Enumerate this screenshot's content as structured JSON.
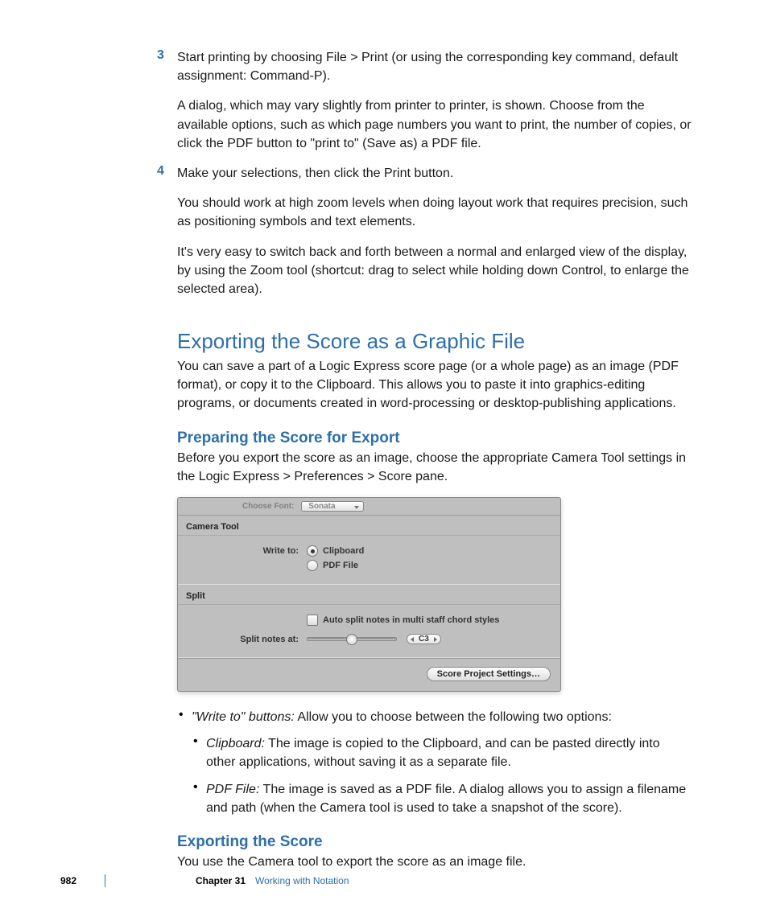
{
  "steps": {
    "s3": {
      "num": "3",
      "main": "Start printing by choosing File > Print (or using the corresponding key command, default assignment:  Command-P).",
      "note": "A dialog, which may vary slightly from printer to printer, is shown. Choose from the available options, such as which page numbers you want to print, the number of copies, or click the PDF button to \"print to\" (Save as) a PDF file."
    },
    "s4": {
      "num": "4",
      "main": "Make your selections, then click the Print button.",
      "note1": "You should work at high zoom levels when doing layout work that requires precision, such as positioning symbols and text elements.",
      "note2": "It's very easy to switch back and forth between a normal and enlarged view of the display, by using the Zoom tool (shortcut:  drag to select while holding down Control, to enlarge the selected area)."
    }
  },
  "h1": "Exporting the Score as a Graphic File",
  "h1_body": "You can save a part of a Logic Express score page (or a whole page) as an image (PDF format), or copy it to the Clipboard. This allows you to paste it into graphics-editing programs, or documents created in word-processing or desktop-publishing applications.",
  "h2a": "Preparing the Score for Export",
  "h2a_body": "Before you export the score as an image, choose the appropriate Camera Tool settings in the Logic Express > Preferences > Score pane.",
  "shot": {
    "top_label": "Choose Font:",
    "top_value": "Sonata",
    "sec1": "Camera Tool",
    "write_to": "Write to:",
    "opt_clipboard": "Clipboard",
    "opt_pdf": "PDF File",
    "sec2": "Split",
    "auto_split": "Auto split notes in multi staff chord styles",
    "split_at": "Split notes at:",
    "split_val": "C3",
    "footer_btn": "Score Project Settings…"
  },
  "bullets": {
    "b1_label": "\"Write to\" buttons:",
    "b1_body": "  Allow you to choose between the following two options:",
    "b2_label": "Clipboard:",
    "b2_body": "  The image is copied to the Clipboard, and can be pasted directly into other applications, without saving it as a separate file.",
    "b3_label": "PDF File:",
    "b3_body": "  The image is saved as a PDF file. A dialog allows you to assign a filename and path (when the Camera tool is used to take a snapshot of the score)."
  },
  "h2b": "Exporting the Score",
  "h2b_body": "You use the Camera tool to export the score as an image file.",
  "footer": {
    "page": "982",
    "chapter": "Chapter 31",
    "title": "Working with Notation"
  }
}
